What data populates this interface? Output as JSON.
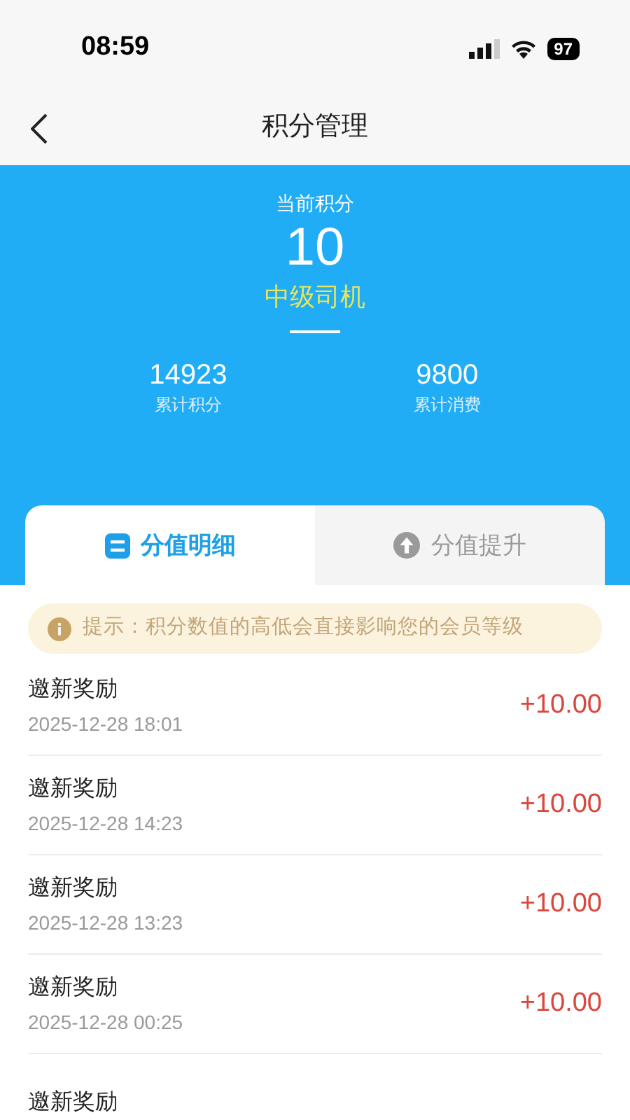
{
  "status_bar": {
    "time": "08:59",
    "battery": "97"
  },
  "nav": {
    "title": "积分管理"
  },
  "summary": {
    "label": "当前积分",
    "points": "10",
    "level_name": "中级司机",
    "stats": [
      {
        "value": "14923",
        "label": "累计积分"
      },
      {
        "value": "9800",
        "label": "累计消费"
      }
    ]
  },
  "tabs": [
    {
      "label": "分值明细",
      "kind": "list",
      "selected": true
    },
    {
      "label": "分值提升",
      "kind": "up",
      "selected": false
    }
  ],
  "notice": "提示：积分数值的高低会直接影响您的会员等级",
  "records": [
    {
      "title": "邀新奖励",
      "time": "2025-12-28 18:01",
      "amount": "+10.00"
    },
    {
      "title": "邀新奖励",
      "time": "2025-12-28 14:23",
      "amount": "+10.00"
    },
    {
      "title": "邀新奖励",
      "time": "2025-12-28 13:23",
      "amount": "+10.00"
    },
    {
      "title": "邀新奖励",
      "time": "2025-12-28 00:25",
      "amount": "+10.00"
    },
    {
      "title": "邀新奖励"
    }
  ]
}
